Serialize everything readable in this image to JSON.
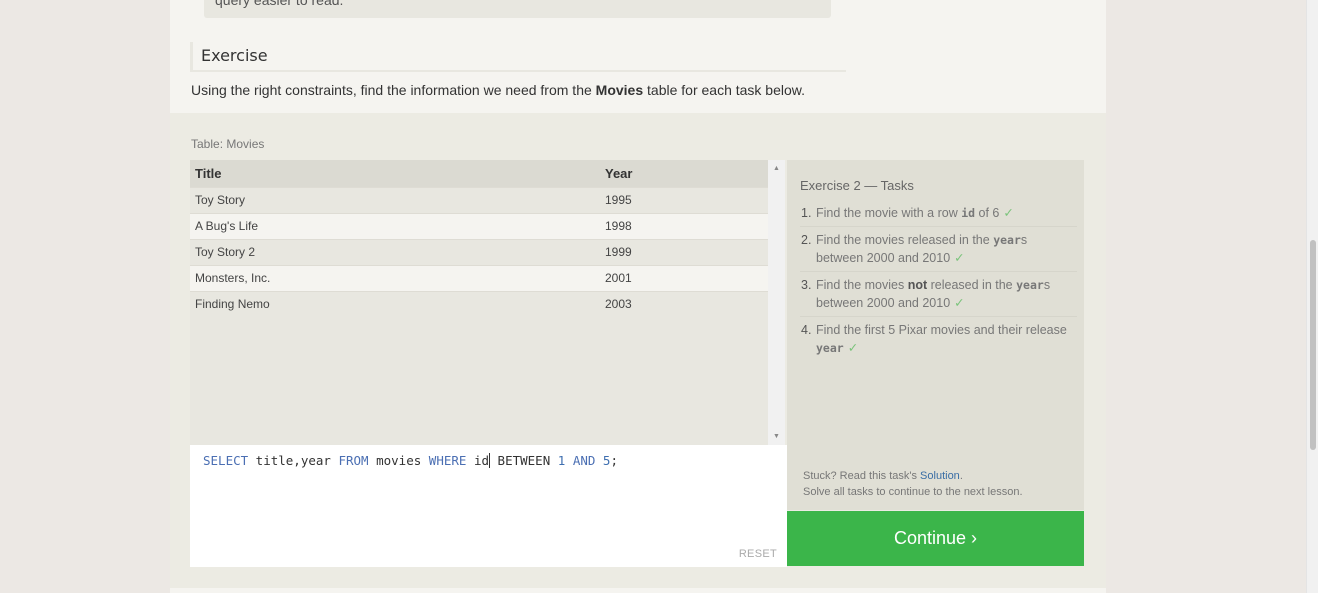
{
  "previous_note": {
    "text": "query easier to read."
  },
  "exercise": {
    "heading": "Exercise",
    "intro_before": "Using the right constraints, find the information we need from the ",
    "intro_bold": "Movies",
    "intro_after": " table for each task below."
  },
  "table": {
    "caption": "Table: Movies",
    "columns": [
      "Title",
      "Year"
    ],
    "rows": [
      {
        "title": "Toy Story",
        "year": "1995"
      },
      {
        "title": "A Bug's Life",
        "year": "1998"
      },
      {
        "title": "Toy Story 2",
        "year": "1999"
      },
      {
        "title": "Monsters, Inc.",
        "year": "2001"
      },
      {
        "title": "Finding Nemo",
        "year": "2003"
      }
    ],
    "scroll_up_icon": "triangle-up-icon",
    "scroll_down_icon": "triangle-down-icon"
  },
  "editor": {
    "query_parts": [
      {
        "text": "SELECT",
        "kind": "kw"
      },
      {
        "text": " title,year ",
        "kind": "plain"
      },
      {
        "text": "FROM",
        "kind": "kw"
      },
      {
        "text": " movies ",
        "kind": "plain"
      },
      {
        "text": "WHERE",
        "kind": "kw"
      },
      {
        "text": " id",
        "kind": "plain"
      },
      {
        "text": " BETWEEN ",
        "kind": "plain"
      },
      {
        "text": "1",
        "kind": "num"
      },
      {
        "text": " ",
        "kind": "plain"
      },
      {
        "text": "AND",
        "kind": "kw"
      },
      {
        "text": " ",
        "kind": "plain"
      },
      {
        "text": "5",
        "kind": "num"
      },
      {
        "text": ";",
        "kind": "plain"
      }
    ],
    "reset_label": "RESET"
  },
  "tasks": {
    "title": "Exercise 2 — Tasks",
    "items": [
      {
        "number": "1.",
        "parts": [
          {
            "t": "Find the movie with a row "
          },
          {
            "c": "id"
          },
          {
            "t": " of 6"
          }
        ],
        "done": true
      },
      {
        "number": "2.",
        "parts": [
          {
            "t": "Find the movies released in the "
          },
          {
            "c": "year"
          },
          {
            "t": "s between 2000 and 2010"
          }
        ],
        "done": true
      },
      {
        "number": "3.",
        "parts": [
          {
            "t": "Find the movies "
          },
          {
            "b": "not"
          },
          {
            "t": " released in the "
          },
          {
            "c": "year"
          },
          {
            "t": "s between 2000 and 2010"
          }
        ],
        "done": true
      },
      {
        "number": "4.",
        "parts": [
          {
            "t": "Find the first 5 Pixar movies and their release "
          },
          {
            "c": "year"
          }
        ],
        "done": true
      }
    ],
    "check_glyph": "✓"
  },
  "help": {
    "stuck_prefix": "Stuck? Read this task's ",
    "solution_link": "Solution",
    "stuck_suffix": ".",
    "continue_note": "Solve all tasks to continue to the next lesson."
  },
  "continue_button": {
    "label": "Continue ›",
    "color": "#3bb54a"
  }
}
